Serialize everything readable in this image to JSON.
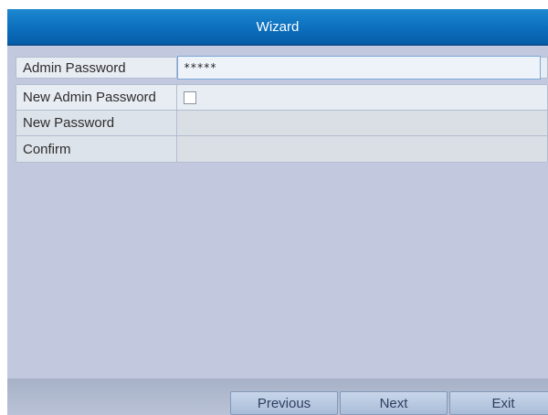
{
  "window": {
    "title": "Wizard"
  },
  "form": {
    "admin_password": {
      "label": "Admin Password",
      "value": "*****"
    },
    "new_admin_password": {
      "label": "New Admin Password",
      "checked": false
    },
    "new_password": {
      "label": "New Password",
      "value": ""
    },
    "confirm": {
      "label": "Confirm",
      "value": ""
    }
  },
  "footer": {
    "previous_label": "Previous",
    "next_label": "Next",
    "exit_label": "Exit"
  },
  "colors": {
    "titlebar": "#0c6fbe",
    "panel": "#c2c9df"
  }
}
